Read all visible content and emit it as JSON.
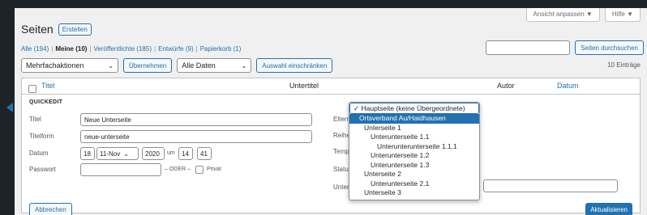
{
  "screen_tabs": {
    "view": "Ansicht anpassen ▼",
    "help": "Hilfe ▼"
  },
  "page_title": "Seiten",
  "add_new": "Erstellen",
  "views": [
    {
      "label": "Alle (194)"
    },
    {
      "label": "Meine (10)"
    },
    {
      "label": "Veröffentlichte (185)"
    },
    {
      "label": "Entwürfe (9)"
    },
    {
      "label": "Papierkorb (1)"
    }
  ],
  "views_sep": "|",
  "search": {
    "value": "",
    "button": "Seiten durchsuchen"
  },
  "bulk": {
    "action": "Mehrfachaktionen",
    "apply": "Übernehmen",
    "dates": "Alle Daten",
    "filter": "Auswahl einschränken"
  },
  "items_count": "10 Einträge",
  "columns": {
    "title": "Titel",
    "subtitle": "Untertitel",
    "author": "Autor",
    "date": "Datum"
  },
  "quickedit": {
    "heading": "QUICKEDIT",
    "title_label": "Titel",
    "title_value": "Neue Unterseite",
    "slug_label": "Titelform",
    "slug_value": "neue-unterseite",
    "date_label": "Datum",
    "day": "18",
    "month": "11-Nov",
    "year": "2020",
    "at": "um",
    "hour": "14",
    "minute": "41",
    "password_label": "Passwort",
    "password_value": "",
    "or_private": "– ODER –",
    "private_label": "Privat",
    "parent_label": "Eltern",
    "order_label": "Reihenfolge",
    "template_label": "Template",
    "status_label": "Status",
    "subtitle_label": "Untertitel",
    "cancel": "Abbrechen",
    "update": "Aktualisieren"
  },
  "parent_dropdown": {
    "selected": "✓ Hauptseite (keine Übergeordnete)",
    "options": [
      {
        "label": "Ortsverband Au/Haidhausen",
        "highlighted": true
      },
      {
        "label": "Unterseite 1",
        "indent": 1
      },
      {
        "label": "Unterunterseite 1.1",
        "indent": 2
      },
      {
        "label": "Unterunterunterseite 1.1.1",
        "indent": 3
      },
      {
        "label": "Unterunterseite 1.2",
        "indent": 2
      },
      {
        "label": "Unterunterseite 1.3",
        "indent": 2
      },
      {
        "label": "Unterseite 2",
        "indent": 1
      },
      {
        "label": "Unterunterseite 2.1",
        "indent": 2
      },
      {
        "label": "Unterseite 3",
        "indent": 1
      }
    ]
  },
  "colors": {
    "accent": "#2271b1",
    "bg": "#f0f0f1",
    "dark": "#1d2327"
  }
}
